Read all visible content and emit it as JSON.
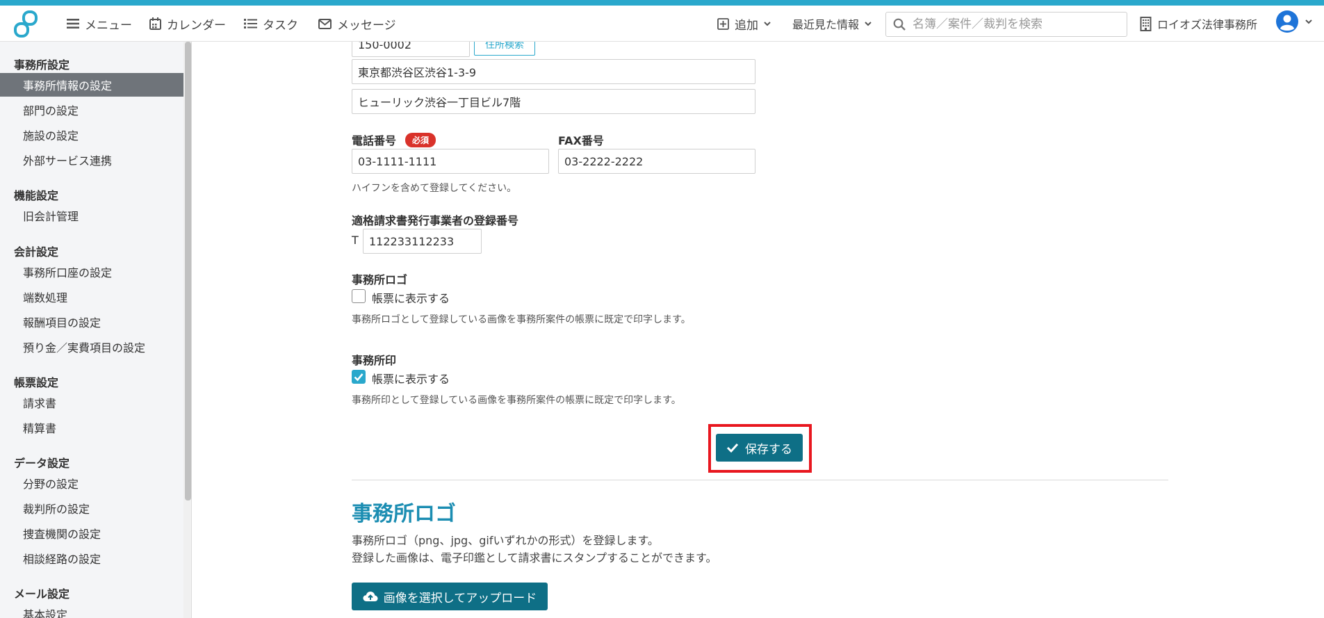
{
  "header": {
    "nav": {
      "menu": "メニュー",
      "calendar": "カレンダー",
      "task": "タスク",
      "message": "メッセージ"
    },
    "add": "追加",
    "recent": "最近見た情報",
    "search_placeholder": "名簿／案件／裁判を検索",
    "office": "ロイオズ法律事務所"
  },
  "sidebar": {
    "sections": [
      {
        "title": "事務所設定",
        "items": [
          "事務所情報の設定",
          "部門の設定",
          "施設の設定",
          "外部サービス連携"
        ]
      },
      {
        "title": "機能設定",
        "items": [
          "旧会計管理"
        ]
      },
      {
        "title": "会計設定",
        "items": [
          "事務所口座の設定",
          "端数処理",
          "報酬項目の設定",
          "預り金／実費項目の設定"
        ]
      },
      {
        "title": "帳票設定",
        "items": [
          "請求書",
          "精算書"
        ]
      },
      {
        "title": "データ設定",
        "items": [
          "分野の設定",
          "裁判所の設定",
          "捜査機関の設定",
          "相談経路の設定"
        ]
      },
      {
        "title": "メール設定",
        "items": [
          "基本設定"
        ]
      }
    ],
    "active": "事務所情報の設定"
  },
  "form": {
    "postal": "150-0002",
    "address_search": "住所検索",
    "address1": "東京都渋谷区渋谷1-3-9",
    "address2": "ヒューリック渋谷一丁目ビル7階",
    "phone_label": "電話番号",
    "required": "必須",
    "phone": "03-1111-1111",
    "fax_label": "FAX番号",
    "fax": "03-2222-2222",
    "phone_hint": "ハイフンを含めて登録してください。",
    "invoice_label": "適格請求書発行事業者の登録番号",
    "invoice_prefix": "T",
    "invoice_number": "112233112233",
    "logo_label": "事務所ロゴ",
    "logo_checkbox": "帳票に表示する",
    "logo_checked": false,
    "logo_hint": "事務所ロゴとして登録している画像を事務所案件の帳票に既定で印字します。",
    "seal_label": "事務所印",
    "seal_checkbox": "帳票に表示する",
    "seal_checked": true,
    "seal_hint": "事務所印として登録している画像を事務所案件の帳票に既定で印字します。",
    "save": "保存する"
  },
  "logo_section": {
    "title": "事務所ロゴ",
    "desc1": "事務所ロゴ（png、jpg、gifいずれかの形式）を登録します。",
    "desc2": "登録した画像は、電子印鑑として請求書にスタンプすることができます。",
    "upload": "画像を選択してアップロード"
  },
  "colors": {
    "accent": "#2aa8cc",
    "primary_button": "#0e6f86",
    "required": "#d9322a",
    "highlight": "#e8171f",
    "title": "#1b8db2"
  }
}
